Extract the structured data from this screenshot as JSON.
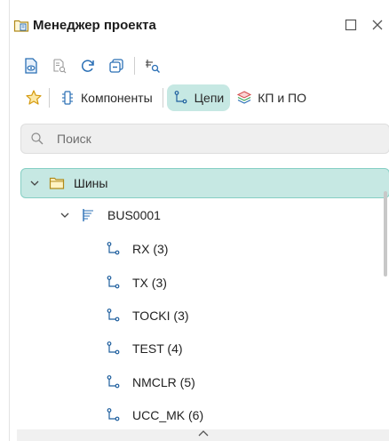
{
  "window": {
    "title": "Менеджер проекта",
    "icon": "folder-doc-icon"
  },
  "toolbar": {
    "buttons": [
      "view-doc-icon",
      "doc-search-icon",
      "refresh-icon",
      "collapse-all-icon",
      "filter-search-icon"
    ]
  },
  "tabs": [
    {
      "label": "Компоненты",
      "icon": "component-icon",
      "active": false
    },
    {
      "label": "Цепи",
      "icon": "net-icon",
      "active": true
    },
    {
      "label": "КП и ПО",
      "icon": "layers-icon",
      "active": false
    }
  ],
  "search": {
    "placeholder": "Поиск",
    "value": ""
  },
  "tree": {
    "root": {
      "label": "Шины",
      "icon": "folder-icon",
      "expanded": true,
      "selected": true
    },
    "bus": {
      "label": "BUS0001",
      "icon": "bus-icon",
      "expanded": true
    },
    "nets": [
      {
        "label": "RX (3)"
      },
      {
        "label": "TX (3)"
      },
      {
        "label": "TOCKI (3)"
      },
      {
        "label": "TEST (4)"
      },
      {
        "label": "NMCLR (5)"
      },
      {
        "label": "UCC_MK (6)"
      }
    ]
  },
  "colors": {
    "accent_bg": "#c6e8e3",
    "accent_border": "#86cfc4",
    "net_icon": "#1f5f9e",
    "star": "#e6a817"
  }
}
